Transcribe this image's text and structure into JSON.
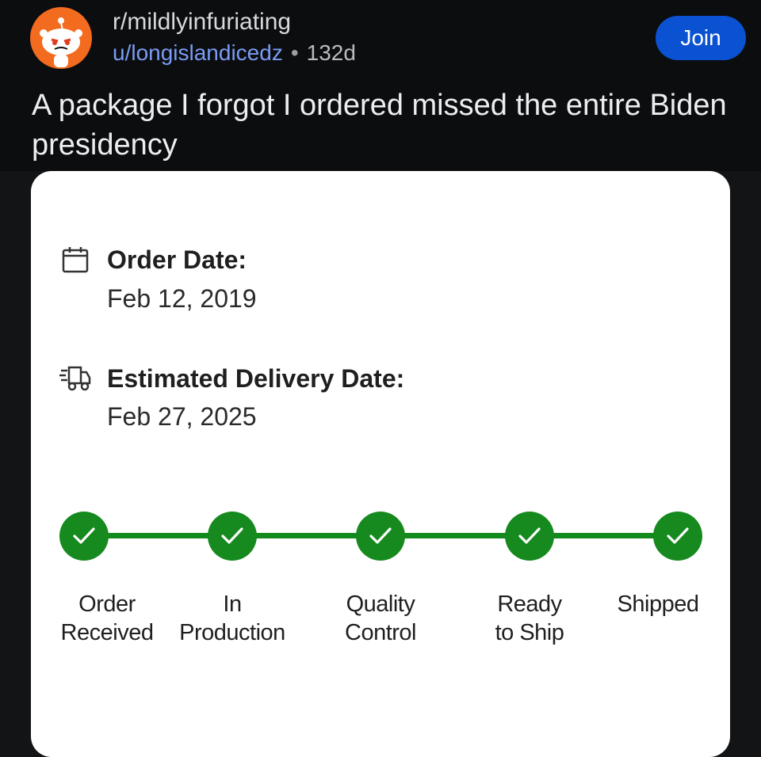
{
  "post": {
    "subreddit": "r/mildlyinfuriating",
    "username": "u/longislandicedz",
    "separator": "•",
    "age": "132d",
    "join_label": "Join",
    "title": "A package I forgot I ordered missed the entire Biden presidency"
  },
  "order": {
    "order_date_label": "Order Date:",
    "order_date_value": "Feb 12, 2019",
    "delivery_label": "Estimated Delivery Date:",
    "delivery_value": "Feb 27, 2025",
    "steps": [
      {
        "label": "Order Received",
        "completed": true
      },
      {
        "label": "In Production",
        "completed": true
      },
      {
        "label": "Quality Control",
        "completed": true
      },
      {
        "label": "Ready to Ship",
        "completed": true
      },
      {
        "label": "Shipped",
        "completed": true
      }
    ]
  },
  "colors": {
    "header_bg": "#0c0d0f",
    "avatar_bg": "#f26b1e",
    "join_bg": "#0a52d1",
    "username": "#7a9cf5",
    "step_complete": "#168a1e"
  },
  "icons": {
    "avatar": "reddit-snoo-icon",
    "order_date": "calendar-icon",
    "delivery": "delivery-truck-icon",
    "step": "checkmark-icon"
  }
}
